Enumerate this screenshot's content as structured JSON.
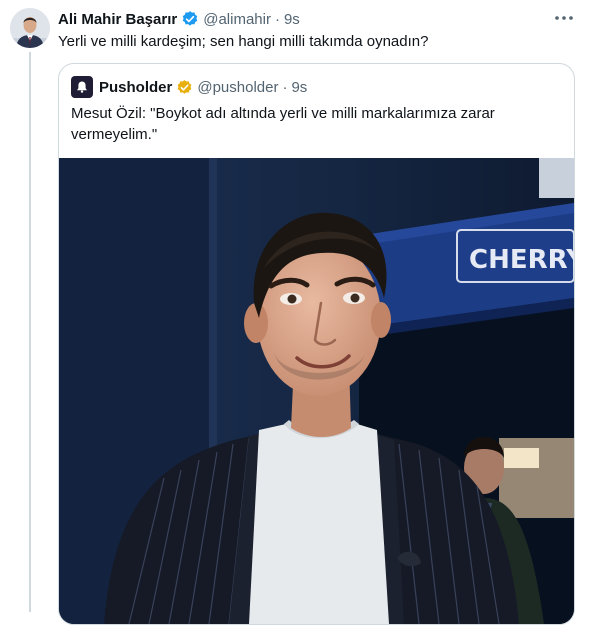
{
  "tweet": {
    "author_name": "Ali Mahir Başarır",
    "handle": "@alimahir",
    "separator": "·",
    "time": "9s",
    "text": "Yerli ve milli kardeşim; sen hangi milli takımda oynadın?",
    "verified_color": "#1d9bf0",
    "more_icon": "more-horizontal-icon"
  },
  "quoted_tweet": {
    "author_name": "Pusholder",
    "handle": "@pusholder",
    "separator": "·",
    "time": "9s",
    "text": "Mesut Özil: \"Boykot adı altında yerli ve milli markalarımıza zarar vermeyelim.\"",
    "verified_color": "#e8b00f",
    "media": {
      "sign_text": "CHERRY",
      "sign_color": "#1f3e8a"
    }
  }
}
